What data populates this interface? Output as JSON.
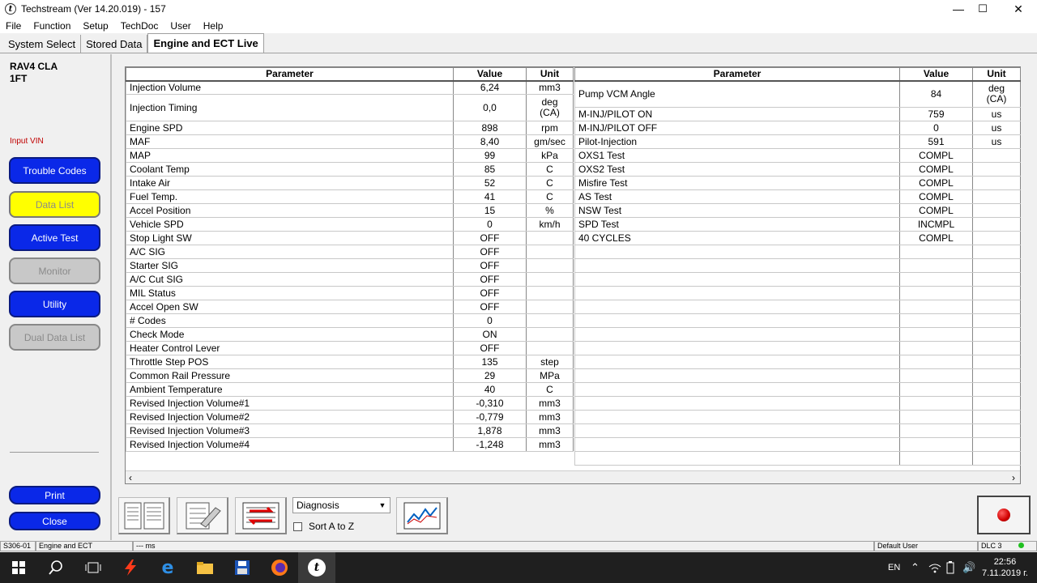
{
  "window": {
    "title": "Techstream (Ver 14.20.019) - 157",
    "min": "—",
    "max": "☐",
    "close": "✕"
  },
  "menu": [
    "File",
    "Function",
    "Setup",
    "TechDoc",
    "User",
    "Help"
  ],
  "tabs": [
    "System Select",
    "Stored Data",
    "Engine and ECT Live"
  ],
  "vehicle": {
    "line1": "RAV4 CLA",
    "line2": "1FT"
  },
  "input_vin": "Input VIN",
  "sidebar": {
    "trouble_codes": "Trouble Codes",
    "data_list": "Data List",
    "active_test": "Active Test",
    "monitor": "Monitor",
    "utility": "Utility",
    "dual_data_list": "Dual Data List",
    "print": "Print",
    "close": "Close"
  },
  "table_headers": {
    "parameter": "Parameter",
    "value": "Value",
    "unit": "Unit"
  },
  "left_rows": [
    [
      "Injection Volume",
      "6,24",
      "mm3"
    ],
    [
      "Injection Timing",
      "0,0",
      "deg\n(CA)"
    ],
    [
      "Engine SPD",
      "898",
      "rpm"
    ],
    [
      "MAF",
      "8,40",
      "gm/sec"
    ],
    [
      "MAP",
      "99",
      "kPa"
    ],
    [
      "Coolant Temp",
      "85",
      "C"
    ],
    [
      "Intake Air",
      "52",
      "C"
    ],
    [
      "Fuel Temp.",
      "41",
      "C"
    ],
    [
      "Accel Position",
      "15",
      "%"
    ],
    [
      "Vehicle SPD",
      "0",
      "km/h"
    ],
    [
      "Stop Light SW",
      "OFF",
      ""
    ],
    [
      "A/C SIG",
      "OFF",
      ""
    ],
    [
      "Starter SIG",
      "OFF",
      ""
    ],
    [
      "A/C Cut SIG",
      "OFF",
      ""
    ],
    [
      "MIL Status",
      "OFF",
      ""
    ],
    [
      "Accel Open SW",
      "OFF",
      ""
    ],
    [
      "# Codes",
      "0",
      ""
    ],
    [
      "Check Mode",
      "ON",
      ""
    ],
    [
      "Heater Control Lever",
      "OFF",
      ""
    ],
    [
      "Throttle Step POS",
      "135",
      "step"
    ],
    [
      "Common Rail Pressure",
      "29",
      "MPa"
    ],
    [
      "Ambient Temperature",
      "40",
      "C"
    ],
    [
      "Revised Injection Volume#1",
      "-0,310",
      "mm3"
    ],
    [
      "Revised Injection Volume#2",
      "-0,779",
      "mm3"
    ],
    [
      "Revised Injection Volume#3",
      "1,878",
      "mm3"
    ],
    [
      "Revised Injection Volume#4",
      "-1,248",
      "mm3"
    ]
  ],
  "right_rows": [
    [
      "Pump VCM Angle",
      "84",
      "deg\n(CA)"
    ],
    [
      "M-INJ/PILOT ON",
      "759",
      "us"
    ],
    [
      "M-INJ/PILOT OFF",
      "0",
      "us"
    ],
    [
      "Pilot-Injection",
      "591",
      "us"
    ],
    [
      "OXS1 Test",
      "COMPL",
      ""
    ],
    [
      "OXS2 Test",
      "COMPL",
      ""
    ],
    [
      "Misfire Test",
      "COMPL",
      ""
    ],
    [
      "AS Test",
      "COMPL",
      ""
    ],
    [
      "NSW Test",
      "COMPL",
      ""
    ],
    [
      "SPD Test",
      "INCMPL",
      ""
    ],
    [
      "40 CYCLES",
      "COMPL",
      ""
    ]
  ],
  "toolbar": {
    "select_value": "Diagnosis",
    "sort_label": "Sort A to Z"
  },
  "status": {
    "code": "S306-01",
    "system": "Engine and ECT",
    "ms": "--- ms",
    "user": "Default User",
    "dlc": "DLC 3"
  },
  "taskbar": {
    "lang": "EN",
    "time": "22:56",
    "date": "7.11.2019 г."
  },
  "colors": {
    "button_blue": "#0a28e8",
    "button_yellow": "#ffff00",
    "button_gray": "#c8c8c8",
    "input_vin_red": "#c00000",
    "record_red": "#d00000"
  }
}
